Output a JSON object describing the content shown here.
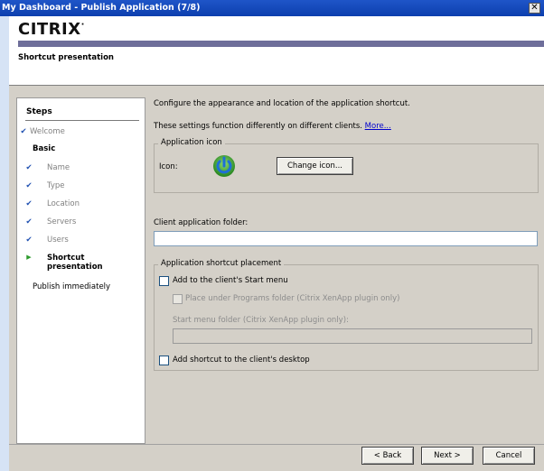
{
  "window": {
    "title": "My Dashboard - Publish Application (7/8)",
    "close_glyph": "✕"
  },
  "banner": {
    "logo": "CITRIX",
    "logo_suffix": "·",
    "page_title": "Shortcut presentation"
  },
  "steps": {
    "heading": "Steps",
    "items": [
      {
        "label": "Welcome",
        "state": "done",
        "mark": "✔"
      },
      {
        "label": "Basic",
        "state": "section",
        "mark": ""
      },
      {
        "label": "Name",
        "state": "done",
        "mark": "✔"
      },
      {
        "label": "Type",
        "state": "done",
        "mark": "✔"
      },
      {
        "label": "Location",
        "state": "done",
        "mark": "✔"
      },
      {
        "label": "Servers",
        "state": "done",
        "mark": "✔"
      },
      {
        "label": "Users",
        "state": "done",
        "mark": "✔"
      },
      {
        "label": "Shortcut presentation",
        "state": "current",
        "mark": "▶"
      },
      {
        "label": "Publish immediately",
        "state": "pending",
        "mark": ""
      }
    ]
  },
  "main": {
    "intro": "Configure the appearance and location of the application shortcut.",
    "note": "These settings function differently on different clients.",
    "more_link": "More...",
    "app_icon_group": {
      "legend": "Application icon",
      "icon_label": "Icon:",
      "change_button": "Change icon..."
    },
    "client_folder": {
      "label": "Client application folder:",
      "value": ""
    },
    "placement_group": {
      "legend": "Application shortcut placement",
      "start_menu": {
        "label": "Add to the client's Start menu",
        "checked": false
      },
      "programs_folder": {
        "label": "Place under Programs folder (Citrix XenApp plugin only)",
        "checked": false,
        "enabled": false
      },
      "start_menu_folder": {
        "label": "Start menu folder (Citrix XenApp plugin only):",
        "value": ""
      },
      "desktop": {
        "label": "Add shortcut to the client's desktop",
        "checked": false
      }
    }
  },
  "footer": {
    "back": "< Back",
    "next": "Next >",
    "cancel": "Cancel"
  },
  "colors": {
    "titlebar": "#0d3fae",
    "banner_bar": "#6e6e9a",
    "check": "#1e4fb0",
    "link": "#0000cc",
    "logo_dot": "#d61b1b",
    "icon_green": "#3a9a2e",
    "icon_blue": "#1e6fd6"
  }
}
